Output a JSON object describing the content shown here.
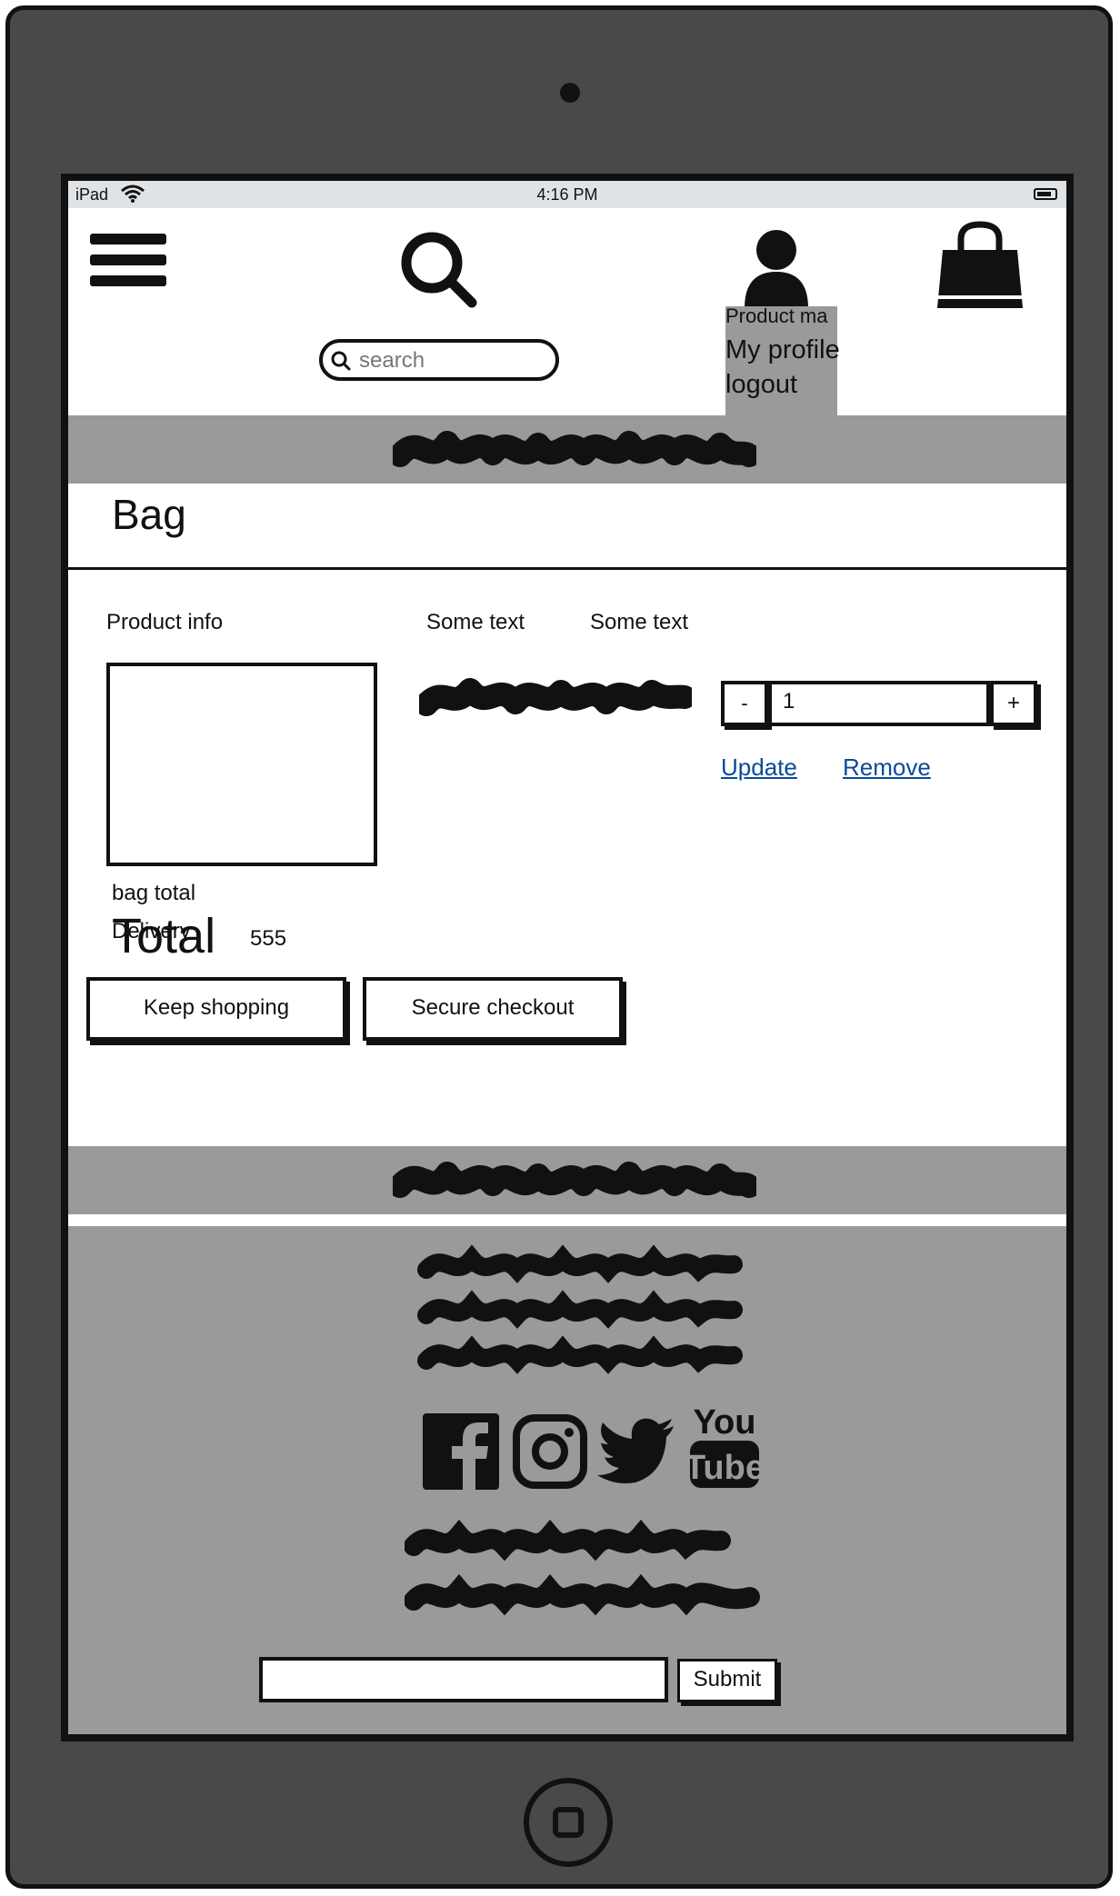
{
  "status_bar": {
    "carrier": "iPad",
    "time": "4:16 PM"
  },
  "header": {
    "search_placeholder": "search",
    "icons": [
      "menu-icon",
      "search-icon",
      "user-icon",
      "shopping-bag-icon"
    ],
    "profile_menu": {
      "title": "Product ma",
      "items": [
        "My profile",
        "logout"
      ]
    }
  },
  "bag": {
    "title": "Bag",
    "columns": [
      "Product info",
      "Some text",
      "Some text"
    ],
    "quantity": {
      "minus": "-",
      "value": "1",
      "plus": "+"
    },
    "actions": {
      "update": "Update",
      "remove": "Remove"
    }
  },
  "summary": {
    "bag_total_label": "bag total",
    "delivery_label": "Delivery",
    "total_label": "Total",
    "total_value": "555"
  },
  "buttons": {
    "keep_shopping": "Keep shopping",
    "secure_checkout": "Secure checkout"
  },
  "footer": {
    "social": [
      "facebook-icon",
      "instagram-icon",
      "twitter-icon",
      "youtube-icon"
    ],
    "youtube_text": [
      "You",
      "Tube"
    ],
    "submit": "Submit"
  },
  "colors": {
    "device": "#494949",
    "banner": "#9a9a9a",
    "link": "#0a4a9a",
    "statusbar": "#dfe3e5"
  }
}
